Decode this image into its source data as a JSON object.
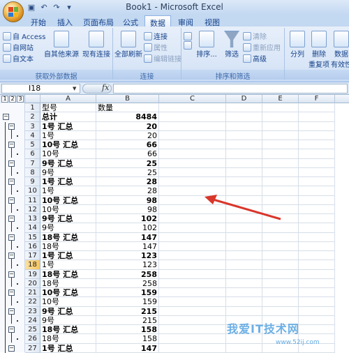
{
  "window": {
    "title": "Book1 - Microsoft Excel"
  },
  "tabs": [
    "开始",
    "插入",
    "页面布局",
    "公式",
    "数据",
    "审阅",
    "视图"
  ],
  "active_tab": "数据",
  "ribbon": {
    "get_external": {
      "label": "获取外部数据",
      "access": "自 Access",
      "web": "自网站",
      "text": "自文本",
      "other": "自其他来源",
      "existing": "现有连接"
    },
    "connections": {
      "label": "连接",
      "refresh_all": "全部刷新",
      "connections": "连接",
      "properties": "属性",
      "edit_links": "编辑链接"
    },
    "sort_filter": {
      "label": "排序和筛选",
      "sort": "排序...",
      "filter": "筛选",
      "clear": "清除",
      "reapply": "重新应用",
      "advanced": "高级"
    },
    "data_tools": {
      "text_to_columns": "分列",
      "remove_duplicates": "删除\n重复项",
      "validation": "数据\n有效性"
    }
  },
  "formula_bar": {
    "name_box": "I18",
    "fx": "fx",
    "formula": ""
  },
  "columns": [
    "A",
    "B",
    "C",
    "D",
    "E",
    "F"
  ],
  "outline_levels": [
    "1",
    "2",
    "3"
  ],
  "rows": [
    {
      "n": "1",
      "a": "型号",
      "b": "数量",
      "bold": false,
      "num": false
    },
    {
      "n": "2",
      "a": "总计",
      "b": "8484",
      "bold": true,
      "num": true
    },
    {
      "n": "3",
      "a": "1号 汇总",
      "b": "20",
      "bold": true,
      "num": true
    },
    {
      "n": "4",
      "a": "1号",
      "b": "20",
      "bold": false,
      "num": true
    },
    {
      "n": "5",
      "a": "10号 汇总",
      "b": "66",
      "bold": true,
      "num": true
    },
    {
      "n": "6",
      "a": "10号",
      "b": "66",
      "bold": false,
      "num": true
    },
    {
      "n": "7",
      "a": "9号 汇总",
      "b": "25",
      "bold": true,
      "num": true
    },
    {
      "n": "8",
      "a": "9号",
      "b": "25",
      "bold": false,
      "num": true
    },
    {
      "n": "9",
      "a": "1号 汇总",
      "b": "28",
      "bold": true,
      "num": true
    },
    {
      "n": "10",
      "a": "1号",
      "b": "28",
      "bold": false,
      "num": true
    },
    {
      "n": "11",
      "a": "10号 汇总",
      "b": "98",
      "bold": true,
      "num": true
    },
    {
      "n": "12",
      "a": "10号",
      "b": "98",
      "bold": false,
      "num": true
    },
    {
      "n": "13",
      "a": "9号 汇总",
      "b": "102",
      "bold": true,
      "num": true
    },
    {
      "n": "14",
      "a": "9号",
      "b": "102",
      "bold": false,
      "num": true
    },
    {
      "n": "15",
      "a": "18号 汇总",
      "b": "147",
      "bold": true,
      "num": true
    },
    {
      "n": "16",
      "a": "18号",
      "b": "147",
      "bold": false,
      "num": true
    },
    {
      "n": "17",
      "a": "1号 汇总",
      "b": "123",
      "bold": true,
      "num": true
    },
    {
      "n": "18",
      "a": "1号",
      "b": "123",
      "bold": false,
      "num": true
    },
    {
      "n": "19",
      "a": "18号 汇总",
      "b": "258",
      "bold": true,
      "num": true
    },
    {
      "n": "20",
      "a": "18号",
      "b": "258",
      "bold": false,
      "num": true
    },
    {
      "n": "21",
      "a": "10号 汇总",
      "b": "159",
      "bold": true,
      "num": true
    },
    {
      "n": "22",
      "a": "10号",
      "b": "159",
      "bold": false,
      "num": true
    },
    {
      "n": "23",
      "a": "9号 汇总",
      "b": "215",
      "bold": true,
      "num": true
    },
    {
      "n": "24",
      "a": "9号",
      "b": "215",
      "bold": false,
      "num": true
    },
    {
      "n": "25",
      "a": "18号 汇总",
      "b": "158",
      "bold": true,
      "num": true
    },
    {
      "n": "26",
      "a": "18号",
      "b": "158",
      "bold": false,
      "num": true
    },
    {
      "n": "27",
      "a": "1号 汇总",
      "b": "147",
      "bold": true,
      "num": true
    }
  ],
  "selected_row": "18",
  "watermark": {
    "text": "我爱IT技术网",
    "url": "www.52ij.com"
  },
  "colors": {
    "accent": "#15428b",
    "arrow": "#d9362b",
    "selection": "#f5c45e"
  }
}
